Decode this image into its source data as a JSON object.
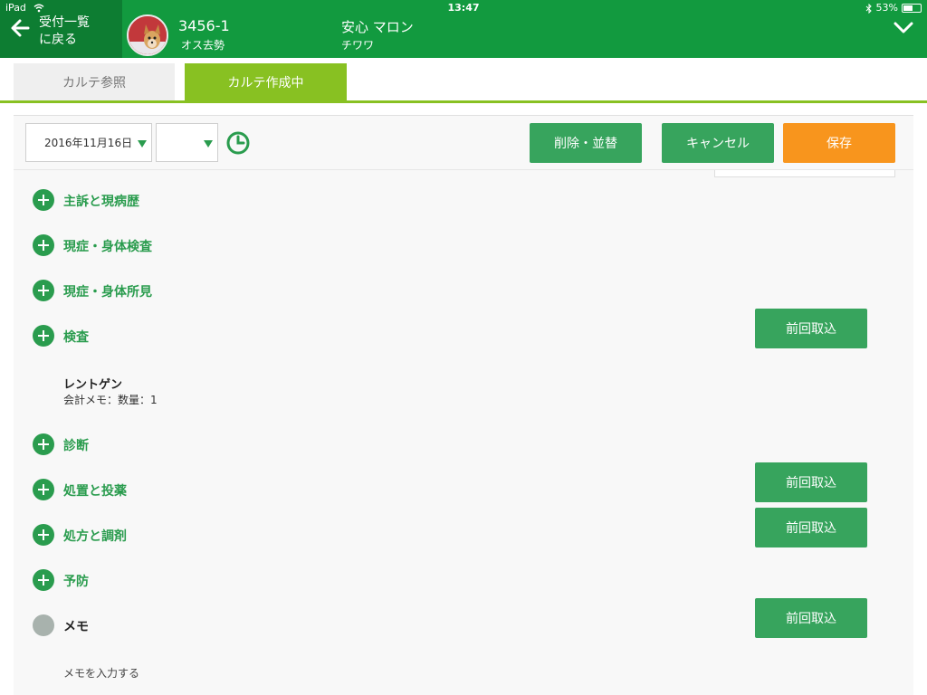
{
  "status_bar": {
    "carrier": "iPad",
    "time": "13:47",
    "battery": "53%",
    "battery_level": 0.53
  },
  "header": {
    "back_label": "受付一覧\nに戻る",
    "patient_id": "3456-1",
    "patient_sex": "オス去勢",
    "owner_name": "安心 マロン",
    "breed": "チワワ"
  },
  "tabs": [
    {
      "label": "カルテ参照",
      "active": false
    },
    {
      "label": "カルテ作成中",
      "active": true
    }
  ],
  "toolbar": {
    "date": "2016年11月16日",
    "time": "",
    "delete_label": "削除・並替",
    "cancel_label": "キャンセル",
    "save_label": "保存"
  },
  "sections": [
    {
      "title": "主訴と現病歴",
      "import_label": null
    },
    {
      "title": "現症・身体検査",
      "import_label": null
    },
    {
      "title": "現症・身体所見",
      "import_label": null
    },
    {
      "title": "検査",
      "import_label": "前回取込"
    },
    {
      "title": "診断",
      "import_label": null
    },
    {
      "title": "処置と投薬",
      "import_label": "前回取込"
    },
    {
      "title": "処方と調剤",
      "import_label": "前回取込"
    },
    {
      "title": "予防",
      "import_label": null
    },
    {
      "title": "メモ",
      "import_label": "前回取込"
    }
  ],
  "exam_entry": {
    "title": "レントゲン",
    "note": "会計メモ：数量：1"
  },
  "memo": {
    "placeholder": "メモを入力する"
  },
  "colors": {
    "header_green": "#129a3f",
    "accent_green": "#2a9c4e",
    "tab_active": "#88c122",
    "save_orange": "#f8951d"
  }
}
